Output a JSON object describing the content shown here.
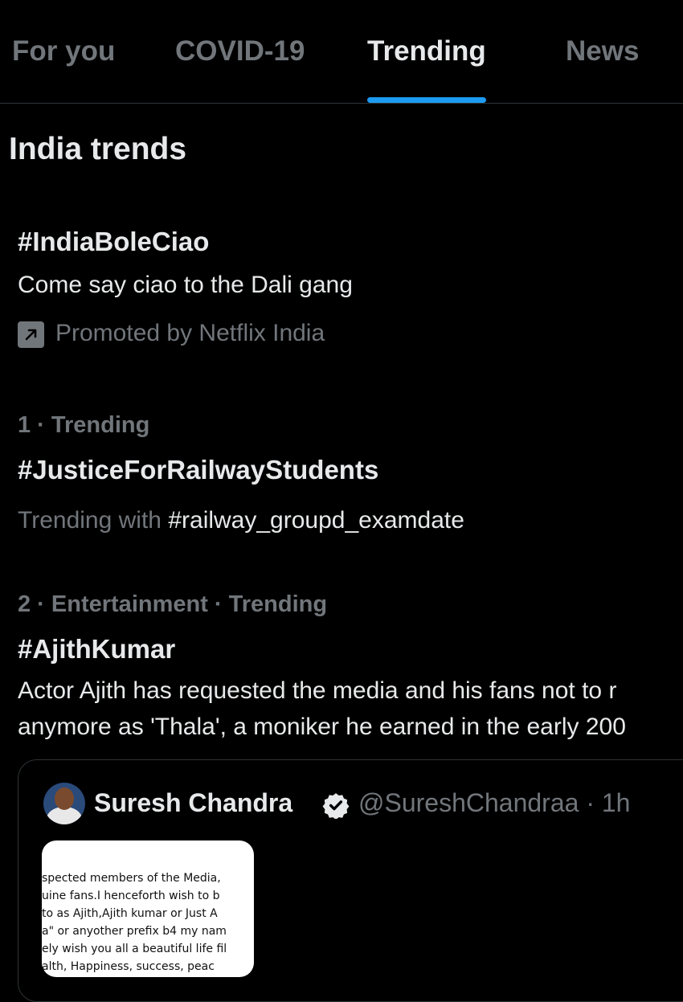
{
  "tabs": [
    {
      "label": "For you"
    },
    {
      "label": "COVID-19"
    },
    {
      "label": "Trending"
    },
    {
      "label": "News"
    }
  ],
  "active_tab": "Trending",
  "colors": {
    "accent": "#1d9bf0",
    "background": "#000000",
    "muted": "#71767b",
    "text": "#e7e9ea"
  },
  "section_title": "India trends",
  "promoted": {
    "hashtag": "#IndiaBoleCiao",
    "description": "Come say ciao to the Dali gang",
    "promoted_by": "Promoted by Netflix India",
    "icon": "promoted-arrow-icon"
  },
  "trends": [
    {
      "meta": "1 · Trending",
      "hashtag": "#JusticeForRailwayStudents",
      "trending_with_label": "Trending with",
      "trending_with_tag": "#railway_groupd_examdate"
    },
    {
      "meta": "2 · Entertainment · Trending",
      "hashtag": "#AjithKumar",
      "description_line1": "Actor Ajith has requested the media and his fans not to r",
      "description_line2": "anymore as 'Thala', a moniker he earned in the early 200"
    }
  ],
  "tweet": {
    "author_name": "Suresh Chandra",
    "author_handle": "@SureshChandraa · 1h",
    "verified_icon": "verified-badge-icon",
    "image_lines": [
      "spected members of the Media,",
      "uine fans.I henceforth wish to b",
      "to as Ajith,Ajith kumar or Just A",
      "a\" or anyother prefix b4 my nam",
      "ely wish you all a beautiful life fil",
      "alth, Happiness, success, peac"
    ]
  }
}
